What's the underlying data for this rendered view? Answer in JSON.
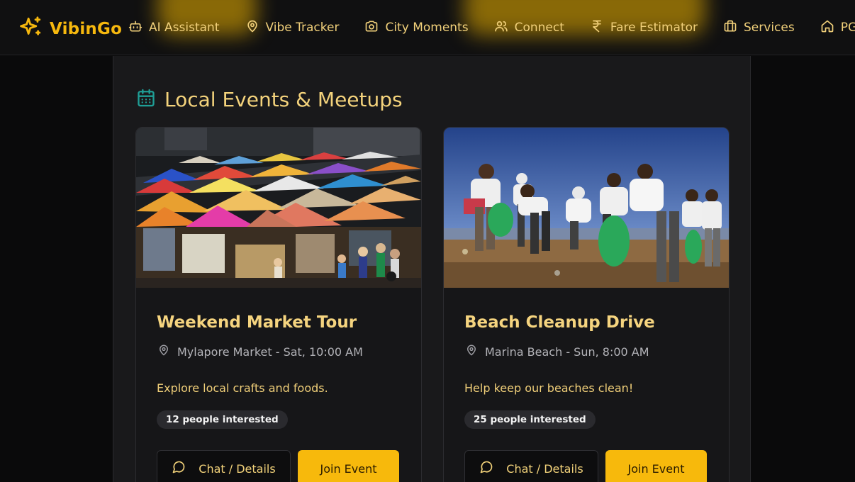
{
  "brand": {
    "name": "VibinGo",
    "icon": "sparkles-icon"
  },
  "nav": {
    "items": [
      {
        "label": "AI Assistant",
        "icon": "bot-icon"
      },
      {
        "label": "Vibe Tracker",
        "icon": "map-pin-icon"
      },
      {
        "label": "City Moments",
        "icon": "camera-icon"
      },
      {
        "label": "Connect",
        "icon": "users-icon"
      },
      {
        "label": "Fare Estimator",
        "icon": "rupee-icon"
      },
      {
        "label": "Services",
        "icon": "briefcase-icon"
      },
      {
        "label": "PG",
        "icon": "home-icon"
      }
    ]
  },
  "section": {
    "title": "Local Events & Meetups",
    "icon": "calendar-icon"
  },
  "events": [
    {
      "title": "Weekend Market Tour",
      "location": "Mylapore Market - Sat, 10:00 AM",
      "description": "Explore local crafts and foods.",
      "interested": "12 people interested",
      "chat_label": "Chat / Details",
      "join_label": "Join Event",
      "image": "night-market-tents"
    },
    {
      "title": "Beach Cleanup Drive",
      "location": "Marina Beach - Sun, 8:00 AM",
      "description": "Help keep our beaches clean!",
      "interested": "25 people interested",
      "chat_label": "Chat / Details",
      "join_label": "Join Event",
      "image": "beach-cleanup-volunteers"
    }
  ],
  "colors": {
    "accent": "#f7b90c",
    "text_gold": "#f4d37c",
    "teal_icon": "#1f9e96",
    "panel": "#19191b",
    "background": "#0a0a0b"
  }
}
